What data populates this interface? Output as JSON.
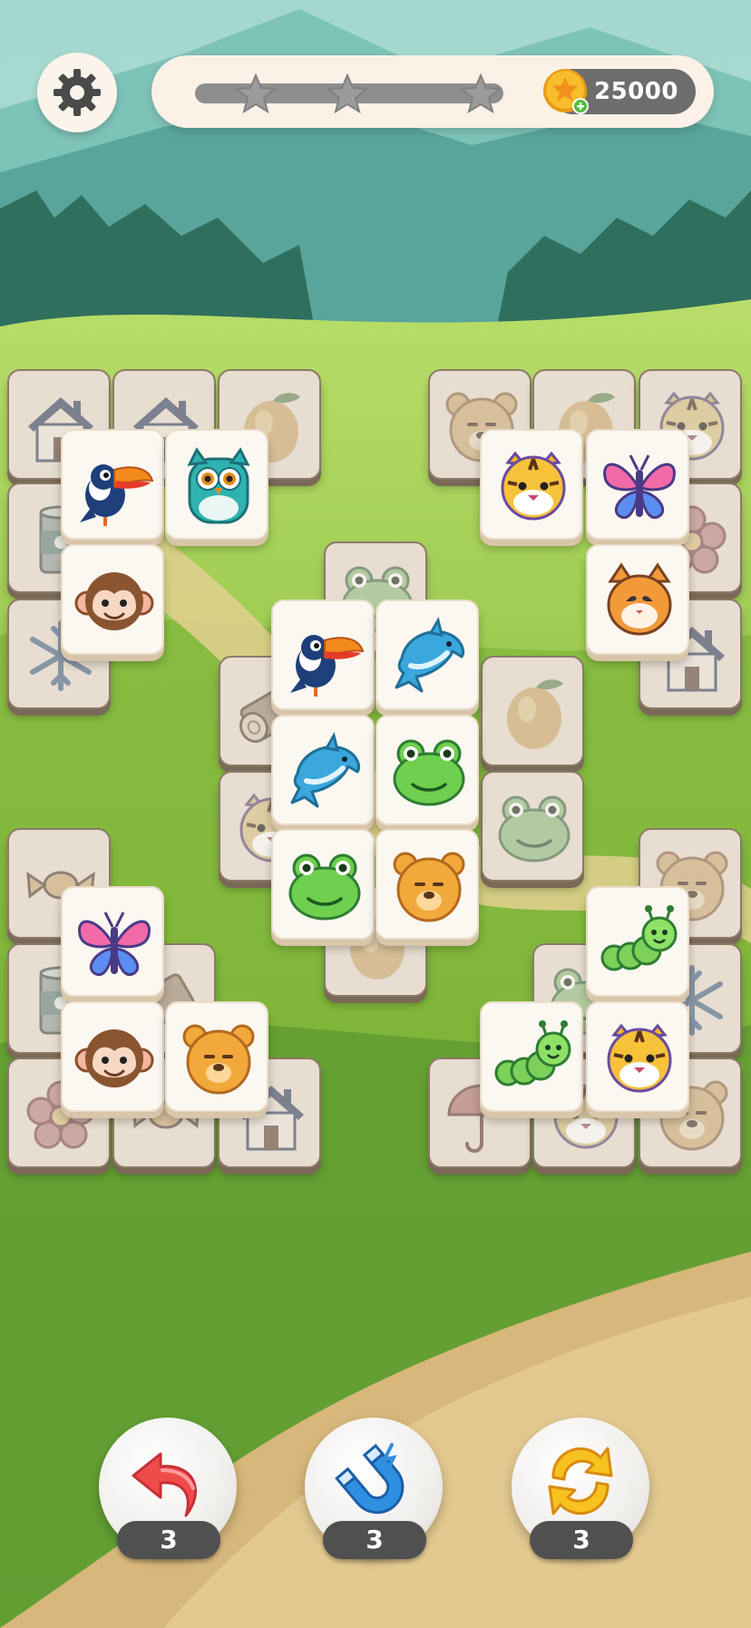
{
  "hud": {
    "settings_icon": "gear-icon",
    "level_progress": 0.0,
    "stars": 3,
    "coins": "25000",
    "coin_icon": "coin-star-icon"
  },
  "board": {
    "tiles": [
      {
        "icon": "house",
        "state": "blocked",
        "group": "top-left"
      },
      {
        "icon": "house",
        "state": "blocked",
        "group": "top-left"
      },
      {
        "icon": "mango",
        "state": "blocked",
        "group": "top-left"
      },
      {
        "icon": "can",
        "state": "blocked",
        "group": "top-left"
      },
      {
        "icon": "snowflake",
        "state": "blocked",
        "group": "top-left"
      },
      {
        "icon": "toucan",
        "state": "active",
        "group": "top-left"
      },
      {
        "icon": "owl",
        "state": "active",
        "group": "top-left"
      },
      {
        "icon": "monkey",
        "state": "active",
        "group": "top-left"
      },
      {
        "icon": "bear",
        "state": "blocked",
        "group": "top-right"
      },
      {
        "icon": "mango",
        "state": "blocked",
        "group": "top-right"
      },
      {
        "icon": "tiger",
        "state": "blocked",
        "group": "top-right"
      },
      {
        "icon": "flower",
        "state": "blocked",
        "group": "top-right"
      },
      {
        "icon": "house",
        "state": "blocked",
        "group": "top-right"
      },
      {
        "icon": "tiger",
        "state": "active",
        "group": "top-right"
      },
      {
        "icon": "butterfly",
        "state": "active",
        "group": "top-right"
      },
      {
        "icon": "cat",
        "state": "active",
        "group": "top-right"
      },
      {
        "icon": "frog",
        "state": "blocked",
        "group": "center"
      },
      {
        "icon": "log",
        "state": "blocked",
        "group": "center"
      },
      {
        "icon": "tiger",
        "state": "blocked",
        "group": "center"
      },
      {
        "icon": "mango",
        "state": "blocked",
        "group": "center"
      },
      {
        "icon": "frog",
        "state": "blocked",
        "group": "center"
      },
      {
        "icon": "mango",
        "state": "blocked",
        "group": "center"
      },
      {
        "icon": "toucan",
        "state": "active",
        "group": "center"
      },
      {
        "icon": "dolphin",
        "state": "active",
        "group": "center"
      },
      {
        "icon": "dolphin",
        "state": "active",
        "group": "center"
      },
      {
        "icon": "frog",
        "state": "active",
        "group": "center"
      },
      {
        "icon": "frog",
        "state": "active",
        "group": "center"
      },
      {
        "icon": "bear",
        "state": "active",
        "group": "center"
      },
      {
        "icon": "candy",
        "state": "blocked",
        "group": "bottom-left"
      },
      {
        "icon": "can",
        "state": "blocked",
        "group": "bottom-left"
      },
      {
        "icon": "log",
        "state": "blocked",
        "group": "bottom-left"
      },
      {
        "icon": "flower",
        "state": "blocked",
        "group": "bottom-left"
      },
      {
        "icon": "candy",
        "state": "blocked",
        "group": "bottom-left"
      },
      {
        "icon": "house",
        "state": "blocked",
        "group": "bottom-left"
      },
      {
        "icon": "butterfly",
        "state": "active",
        "group": "bottom-left"
      },
      {
        "icon": "monkey",
        "state": "active",
        "group": "bottom-left"
      },
      {
        "icon": "bear",
        "state": "active",
        "group": "bottom-left"
      },
      {
        "icon": "bear",
        "state": "blocked",
        "group": "bottom-right"
      },
      {
        "icon": "frog",
        "state": "blocked",
        "group": "bottom-right"
      },
      {
        "icon": "snowflake",
        "state": "blocked",
        "group": "bottom-right"
      },
      {
        "icon": "umbrella",
        "state": "blocked",
        "group": "bottom-right"
      },
      {
        "icon": "tiger",
        "state": "blocked",
        "group": "bottom-right"
      },
      {
        "icon": "bear",
        "state": "blocked",
        "group": "bottom-right"
      },
      {
        "icon": "caterpillar",
        "state": "active",
        "group": "bottom-right"
      },
      {
        "icon": "caterpillar",
        "state": "active",
        "group": "bottom-right"
      },
      {
        "icon": "tiger",
        "state": "active",
        "group": "bottom-right"
      }
    ]
  },
  "powerups": [
    {
      "name": "undo",
      "icon": "undo-arrow-icon",
      "count": "3"
    },
    {
      "name": "magnet",
      "icon": "magnet-icon",
      "count": "3"
    },
    {
      "name": "shuffle",
      "icon": "shuffle-icon",
      "count": "3"
    }
  ],
  "colors": {
    "sky": "#a9dcd3",
    "grass": "#9bcf4a",
    "path": "#e7d49a",
    "tile_face": "#fbf8f1",
    "tile_blocked": "#e7ddd1",
    "coin": "#f6b426",
    "pill": "#6d6d6d"
  }
}
